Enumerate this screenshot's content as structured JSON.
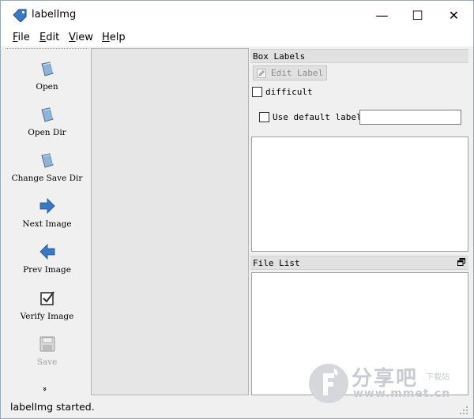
{
  "window": {
    "title": "labelImg",
    "controls": {
      "minimize": "—",
      "maximize": "☐",
      "close": "✕"
    }
  },
  "menu": [
    {
      "underline": "F",
      "rest": "ile"
    },
    {
      "underline": "E",
      "rest": "dit"
    },
    {
      "underline": "V",
      "rest": "iew"
    },
    {
      "underline": "H",
      "rest": "elp"
    }
  ],
  "toolbar": {
    "items": [
      {
        "label": "Open",
        "icon": "folder-open-icon",
        "enabled": true
      },
      {
        "label": "Open Dir",
        "icon": "folder-open-icon",
        "enabled": true
      },
      {
        "label": "Change Save Dir",
        "icon": "folder-open-icon",
        "enabled": true
      },
      {
        "label": "Next Image",
        "icon": "arrow-right-icon",
        "enabled": true
      },
      {
        "label": "Prev Image",
        "icon": "arrow-left-icon",
        "enabled": true
      },
      {
        "label": "Verify Image",
        "icon": "checkbox-checked-icon",
        "enabled": true
      },
      {
        "label": "Save",
        "icon": "floppy-disk-icon",
        "enabled": false
      }
    ],
    "more": "»"
  },
  "box_labels": {
    "title": "Box Labels",
    "edit_label_button": "Edit Label",
    "difficult_label": "difficult",
    "difficult_checked": false,
    "use_default_label": "Use default label",
    "use_default_checked": false,
    "default_label_value": ""
  },
  "file_list": {
    "title": "File List"
  },
  "status": {
    "text": "labelImg started."
  },
  "watermark": {
    "line1": "分享吧",
    "line2": "www.mmet.cn",
    "line3": "下载站"
  },
  "colors": {
    "arrow_blue": "#3b78c3",
    "folder_blue": "#8fb3d9",
    "disabled_gray": "#a0a0a0"
  }
}
